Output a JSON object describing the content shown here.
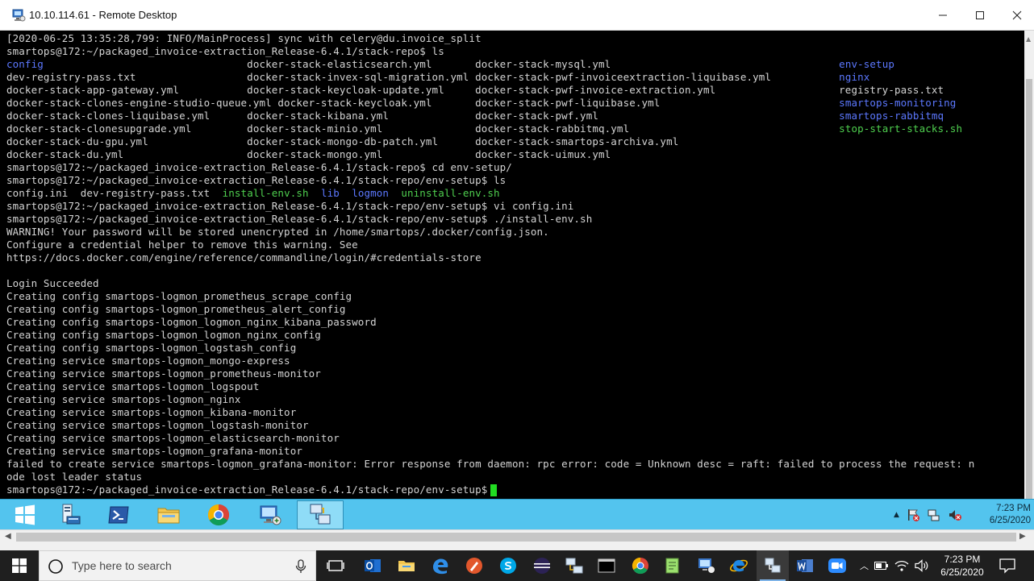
{
  "window": {
    "title": "10.10.114.61 - Remote Desktop"
  },
  "terminal": {
    "lines": [
      [
        {
          "t": "[2020-06-25 13:35:28,799: INFO/MainProcess] sync with celery@du.invoice_split",
          "c": "gray"
        }
      ],
      [
        {
          "t": "smartops@172:~/packaged_invoice-extraction_Release-6.4.1/stack-repo$ ls",
          "c": "gray"
        }
      ],
      [
        {
          "t": "config",
          "c": "blue"
        },
        {
          "t": "                                 docker-stack-elasticsearch.yml       docker-stack-mysql.yml                                     ",
          "c": "gray"
        },
        {
          "t": "env-setup",
          "c": "blue"
        }
      ],
      [
        {
          "t": "dev-registry-pass.txt                  docker-stack-invex-sql-migration.yml docker-stack-pwf-invoiceextraction-liquibase.yml           ",
          "c": "gray"
        },
        {
          "t": "nginx",
          "c": "blue"
        }
      ],
      [
        {
          "t": "docker-stack-app-gateway.yml           docker-stack-keycloak-update.yml     docker-stack-pwf-invoice-extraction.yml                    registry-pass.txt",
          "c": "gray"
        }
      ],
      [
        {
          "t": "docker-stack-clones-engine-studio-queue.yml docker-stack-keycloak.yml       docker-stack-pwf-liquibase.yml                             ",
          "c": "gray"
        },
        {
          "t": "smartops-monitoring",
          "c": "blue"
        }
      ],
      [
        {
          "t": "docker-stack-clones-liquibase.yml      docker-stack-kibana.yml              docker-stack-pwf.yml                                       ",
          "c": "gray"
        },
        {
          "t": "smartops-rabbitmq",
          "c": "blue"
        }
      ],
      [
        {
          "t": "docker-stack-clonesupgrade.yml         docker-stack-minio.yml               docker-stack-rabbitmq.yml                                  ",
          "c": "gray"
        },
        {
          "t": "stop-start-stacks.sh",
          "c": "green"
        }
      ],
      [
        {
          "t": "docker-stack-du-gpu.yml                docker-stack-mongo-db-patch.yml      docker-stack-smartops-archiva.yml",
          "c": "gray"
        }
      ],
      [
        {
          "t": "docker-stack-du.yml                    docker-stack-mongo.yml               docker-stack-uimux.yml",
          "c": "gray"
        }
      ],
      [
        {
          "t": "smartops@172:~/packaged_invoice-extraction_Release-6.4.1/stack-repo$ cd env-setup/",
          "c": "gray"
        }
      ],
      [
        {
          "t": "smartops@172:~/packaged_invoice-extraction_Release-6.4.1/stack-repo/env-setup$ ls",
          "c": "gray"
        }
      ],
      [
        {
          "t": "config.ini  dev-registry-pass.txt  ",
          "c": "gray"
        },
        {
          "t": "install-env.sh",
          "c": "green"
        },
        {
          "t": "  ",
          "c": "gray"
        },
        {
          "t": "lib",
          "c": "blue"
        },
        {
          "t": "  ",
          "c": "gray"
        },
        {
          "t": "logmon",
          "c": "blue"
        },
        {
          "t": "  ",
          "c": "gray"
        },
        {
          "t": "uninstall-env.sh",
          "c": "green"
        }
      ],
      [
        {
          "t": "smartops@172:~/packaged_invoice-extraction_Release-6.4.1/stack-repo/env-setup$ vi config.ini",
          "c": "gray"
        }
      ],
      [
        {
          "t": "smartops@172:~/packaged_invoice-extraction_Release-6.4.1/stack-repo/env-setup$ ./install-env.sh",
          "c": "gray"
        }
      ],
      [
        {
          "t": "WARNING! Your password will be stored unencrypted in /home/smartops/.docker/config.json.",
          "c": "gray"
        }
      ],
      [
        {
          "t": "Configure a credential helper to remove this warning. See",
          "c": "gray"
        }
      ],
      [
        {
          "t": "https://docs.docker.com/engine/reference/commandline/login/#credentials-store",
          "c": "gray"
        }
      ],
      [
        {
          "t": "",
          "c": "gray"
        }
      ],
      [
        {
          "t": "Login Succeeded",
          "c": "gray"
        }
      ],
      [
        {
          "t": "Creating config smartops-logmon_prometheus_scrape_config",
          "c": "gray"
        }
      ],
      [
        {
          "t": "Creating config smartops-logmon_prometheus_alert_config",
          "c": "gray"
        }
      ],
      [
        {
          "t": "Creating config smartops-logmon_logmon_nginx_kibana_password",
          "c": "gray"
        }
      ],
      [
        {
          "t": "Creating config smartops-logmon_logmon_nginx_config",
          "c": "gray"
        }
      ],
      [
        {
          "t": "Creating config smartops-logmon_logstash_config",
          "c": "gray"
        }
      ],
      [
        {
          "t": "Creating service smartops-logmon_mongo-express",
          "c": "gray"
        }
      ],
      [
        {
          "t": "Creating service smartops-logmon_prometheus-monitor",
          "c": "gray"
        }
      ],
      [
        {
          "t": "Creating service smartops-logmon_logspout",
          "c": "gray"
        }
      ],
      [
        {
          "t": "Creating service smartops-logmon_nginx",
          "c": "gray"
        }
      ],
      [
        {
          "t": "Creating service smartops-logmon_kibana-monitor",
          "c": "gray"
        }
      ],
      [
        {
          "t": "Creating service smartops-logmon_logstash-monitor",
          "c": "gray"
        }
      ],
      [
        {
          "t": "Creating service smartops-logmon_elasticsearch-monitor",
          "c": "gray"
        }
      ],
      [
        {
          "t": "Creating service smartops-logmon_grafana-monitor",
          "c": "gray"
        }
      ],
      [
        {
          "t": "failed to create service smartops-logmon_grafana-monitor: Error response from daemon: rpc error: code = Unknown desc = raft: failed to process the request: n",
          "c": "gray"
        }
      ],
      [
        {
          "t": "ode lost leader status",
          "c": "gray"
        }
      ],
      [
        {
          "t": "smartops@172:~/packaged_invoice-extraction_Release-6.4.1/stack-repo/env-setup$",
          "c": "gray"
        }
      ]
    ]
  },
  "remote_taskbar": {
    "apps": [
      {
        "name": "windows-start-icon"
      },
      {
        "name": "server-manager-icon"
      },
      {
        "name": "powershell-icon"
      },
      {
        "name": "file-explorer-icon"
      },
      {
        "name": "chrome-icon"
      },
      {
        "name": "remote-desktop-icon"
      },
      {
        "name": "network-terminal-icon"
      }
    ],
    "time": "7:23 PM",
    "date": "6/25/2020"
  },
  "local_taskbar": {
    "search_placeholder": "Type here to search",
    "time": "7:23 PM",
    "date": "6/25/2020"
  },
  "colors": {
    "terminal_bg": "#000000",
    "dir_blue": "#5c78ff",
    "exec_green": "#4fd04f",
    "remote_taskbar": "#53c4ee",
    "local_taskbar": "#1f1f1f"
  }
}
